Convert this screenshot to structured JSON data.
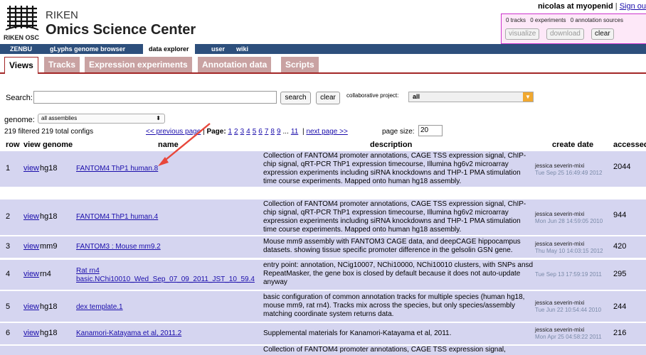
{
  "header": {
    "org": "RIKEN",
    "title": "Omics Science Center",
    "logo_subtext": "RIKEN OSC",
    "user_prefix": "nicolas at myopenid",
    "separator": "|",
    "signout": "Sign ou"
  },
  "cart": {
    "tracks": "0 tracks",
    "experiments": "0 experiments",
    "annotation": "0 annotation sources",
    "visualize": "visualize",
    "download": "download",
    "clear": "clear"
  },
  "nav_main": [
    "ZENBU",
    "gLyphs genome browser",
    "data explorer",
    "user",
    "wiki"
  ],
  "nav_sub": [
    "Views",
    "Tracks",
    "Expression experiments",
    "Annotation data",
    "Scripts"
  ],
  "search": {
    "label": "Search:",
    "value": "",
    "search_btn": "search",
    "clear_btn": "clear",
    "collab_label": "collaborative project:",
    "collab_value": "all"
  },
  "genome_filter": {
    "label": "genome:",
    "value": "all assemblies"
  },
  "listing": {
    "count": "219 filtered 219 total configs",
    "prev": "<< previous page",
    "sep1": "|",
    "page_label": "Page:",
    "pages": [
      "1",
      "2",
      "3",
      "4",
      "5",
      "6",
      "7",
      "8",
      "9",
      "...",
      "11"
    ],
    "sep2": "|",
    "next": "next page >>",
    "page_size_label": "page size:",
    "page_size": "20"
  },
  "table": {
    "headers": [
      "row",
      "view",
      "genome",
      "name",
      "description",
      "create date",
      "accessed"
    ],
    "rows": [
      {
        "num": "1",
        "view": "view",
        "genome": "hg18",
        "name": "FANTOM4 ThP1 human.8",
        "description": "Collection of FANTOM4 promoter annotations, CAGE TSS expression signal, ChIP-chip signal, qRT-PCR ThP1 expression timecourse, Illumina hg6v2 microarray expression experiments including siRNA knockdowns and THP-1 PMA stimulation time course experiments. Mapped onto human hg18 assembly.",
        "creator": "jessica severin-mixi",
        "date": "Tue Sep 25 16:49:49 2012",
        "accessed": "2044"
      },
      {
        "num": "2",
        "view": "view",
        "genome": "hg18",
        "name": "FANTOM4 ThP1 human.4",
        "description": "Collection of FANTOM4 promoter annotations, CAGE TSS expression signal, ChIP-chip signal, qRT-PCR ThP1 expression timecourse, Illumina hg6v2 microarray expression experiments including siRNA knockdowns and THP-1 PMA stimulation time course experiments. Mapped onto human hg18 assembly.",
        "creator": "jessica severin-mixi",
        "date": "Mon Jun 28 14:59:05 2010",
        "accessed": "944"
      },
      {
        "num": "3",
        "view": "view",
        "genome": "mm9",
        "name": "FANTOM3 : Mouse mm9.2",
        "description": "Mouse mm9 assembly with FANTOM3 CAGE data, and deepCAGE hippocampus datasets. showing tissue specific promoter difference in the gelsolin GSN gene.",
        "creator": "jessica severin-mixi",
        "date": "Thu May 10 14:03:15 2012",
        "accessed": "420"
      },
      {
        "num": "4",
        "view": "view",
        "genome": "rn4",
        "name": "Rat rn4 basic.NChi10010_Wed_Sep_07_09_2011_JST_10_59.4",
        "description": "entry point: annotation, NCig10007, NChi10000, NChi10010 clusters, with SNPs ansd RepeatMasker, the gene box is closed by default because it does not auto-update anyway",
        "creator": "",
        "date": "Tue Sep 13 17:59:19 2011",
        "accessed": "295"
      },
      {
        "num": "5",
        "view": "view",
        "genome": "hg18",
        "name": "dex template.1",
        "description": "basic configuration of common annotation tracks for multiple species (human hg18, mouse mm9, rat rn4). Tracks mix across the species, but only species/assembly matching coordinate system returns data.",
        "creator": "jessica severin-mixi",
        "date": "Tue Jun 22 10:54:44 2010",
        "accessed": "244"
      },
      {
        "num": "6",
        "view": "view",
        "genome": "hg18",
        "name": "Kanamori-Katayama et al, 2011.2",
        "description": "Supplemental materials for Kanamori-Katayama et al, 2011.",
        "creator": "jessica severin-mixi",
        "date": "Mon Apr 25 04:58:22 2011",
        "accessed": "216"
      },
      {
        "num": "",
        "view": "",
        "genome": "",
        "name": "",
        "description": "Collection of FANTOM4 promoter annotations, CAGE TSS expression signal,",
        "creator": "",
        "date": "",
        "accessed": ""
      }
    ]
  },
  "colors": {
    "nav_blue": "#2d4f7c",
    "subnav_red": "#a32626",
    "row_highlight": "#d5d5f0",
    "link": "#1a0dab",
    "annotation_arrow": "#e8473b",
    "cart_border": "#cc33cc"
  }
}
